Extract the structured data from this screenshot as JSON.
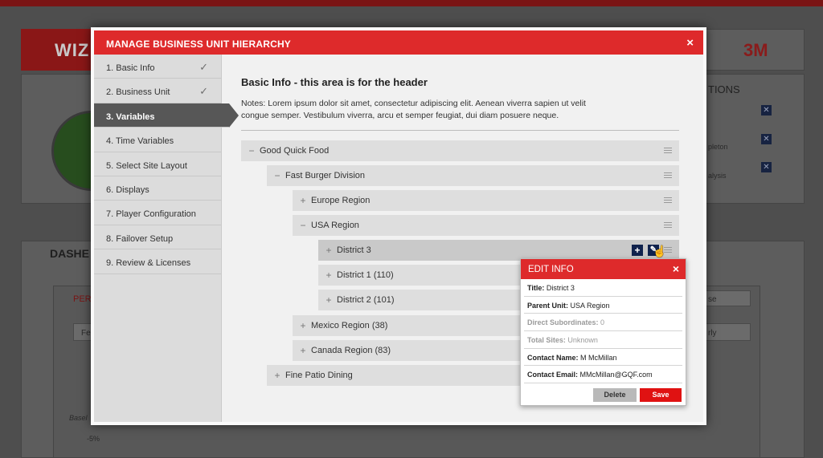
{
  "background": {
    "brand_text": "WIZ",
    "logo_text": "3M",
    "dashboard_label": "DASHE",
    "options_label": "TIONS",
    "perf_label": "PERI",
    "items": [
      "pleton",
      "alysis"
    ],
    "axis_labels": [
      "-5%",
      "Basel"
    ],
    "select_text": [
      "Fe",
      "rly",
      "se"
    ]
  },
  "modal": {
    "title": "MANAGE BUSINESS UNIT HIERARCHY",
    "close": "×",
    "steps": [
      {
        "label": "1. Basic Info",
        "done": "✓"
      },
      {
        "label": "2. Business Unit",
        "done": "✓"
      },
      {
        "label": "3. Variables"
      },
      {
        "label": "4. Time Variables"
      },
      {
        "label": "5. Select Site Layout"
      },
      {
        "label": "6. Displays"
      },
      {
        "label": "7. Player Configuration"
      },
      {
        "label": "8. Failover Setup"
      },
      {
        "label": "9. Review & Licenses"
      }
    ],
    "content": {
      "title": "Basic Info - this area is for the header",
      "notes": "Notes: Lorem ipsum dolor sit amet, consectetur adipiscing elit. Aenean viverra sapien ut velit congue semper. Vestibulum viverra, arcu et semper feugiat, dui diam posuere neque."
    },
    "tree": [
      {
        "toggle": "−",
        "label": "Good Quick Food"
      },
      {
        "toggle": "−",
        "label": "Fast Burger Division"
      },
      {
        "toggle": "+",
        "label": "Europe Region"
      },
      {
        "toggle": "−",
        "label": "USA Region"
      },
      {
        "toggle": "+",
        "label": "District 3",
        "add": "+",
        "edit": "✎"
      },
      {
        "toggle": "+",
        "label": "District 1 (110)"
      },
      {
        "toggle": "+",
        "label": "District 2 (101)"
      },
      {
        "toggle": "+",
        "label": "Mexico Region (38)"
      },
      {
        "toggle": "+",
        "label": "Canada Region (83)"
      },
      {
        "toggle": "+",
        "label": "Fine Patio Dining"
      }
    ]
  },
  "edit_info": {
    "title": "EDIT INFO",
    "close": "×",
    "fields": [
      {
        "key": "Title:",
        "value": "District 3"
      },
      {
        "key": "Parent Unit:",
        "value": "USA Region"
      },
      {
        "key": "Direct Subordinates:",
        "value": "0"
      },
      {
        "key": "Total Sites:",
        "value": "Unknown"
      },
      {
        "key": "Contact Name:",
        "value": "M McMillan"
      },
      {
        "key": "Contact Email:",
        "value": "MMcMillan@GQF.com"
      }
    ],
    "delete_label": "Delete",
    "save_label": "Save"
  },
  "colors": {
    "accent": "#de2a2b",
    "active_step": "#575757",
    "action_button": "#10224d"
  }
}
